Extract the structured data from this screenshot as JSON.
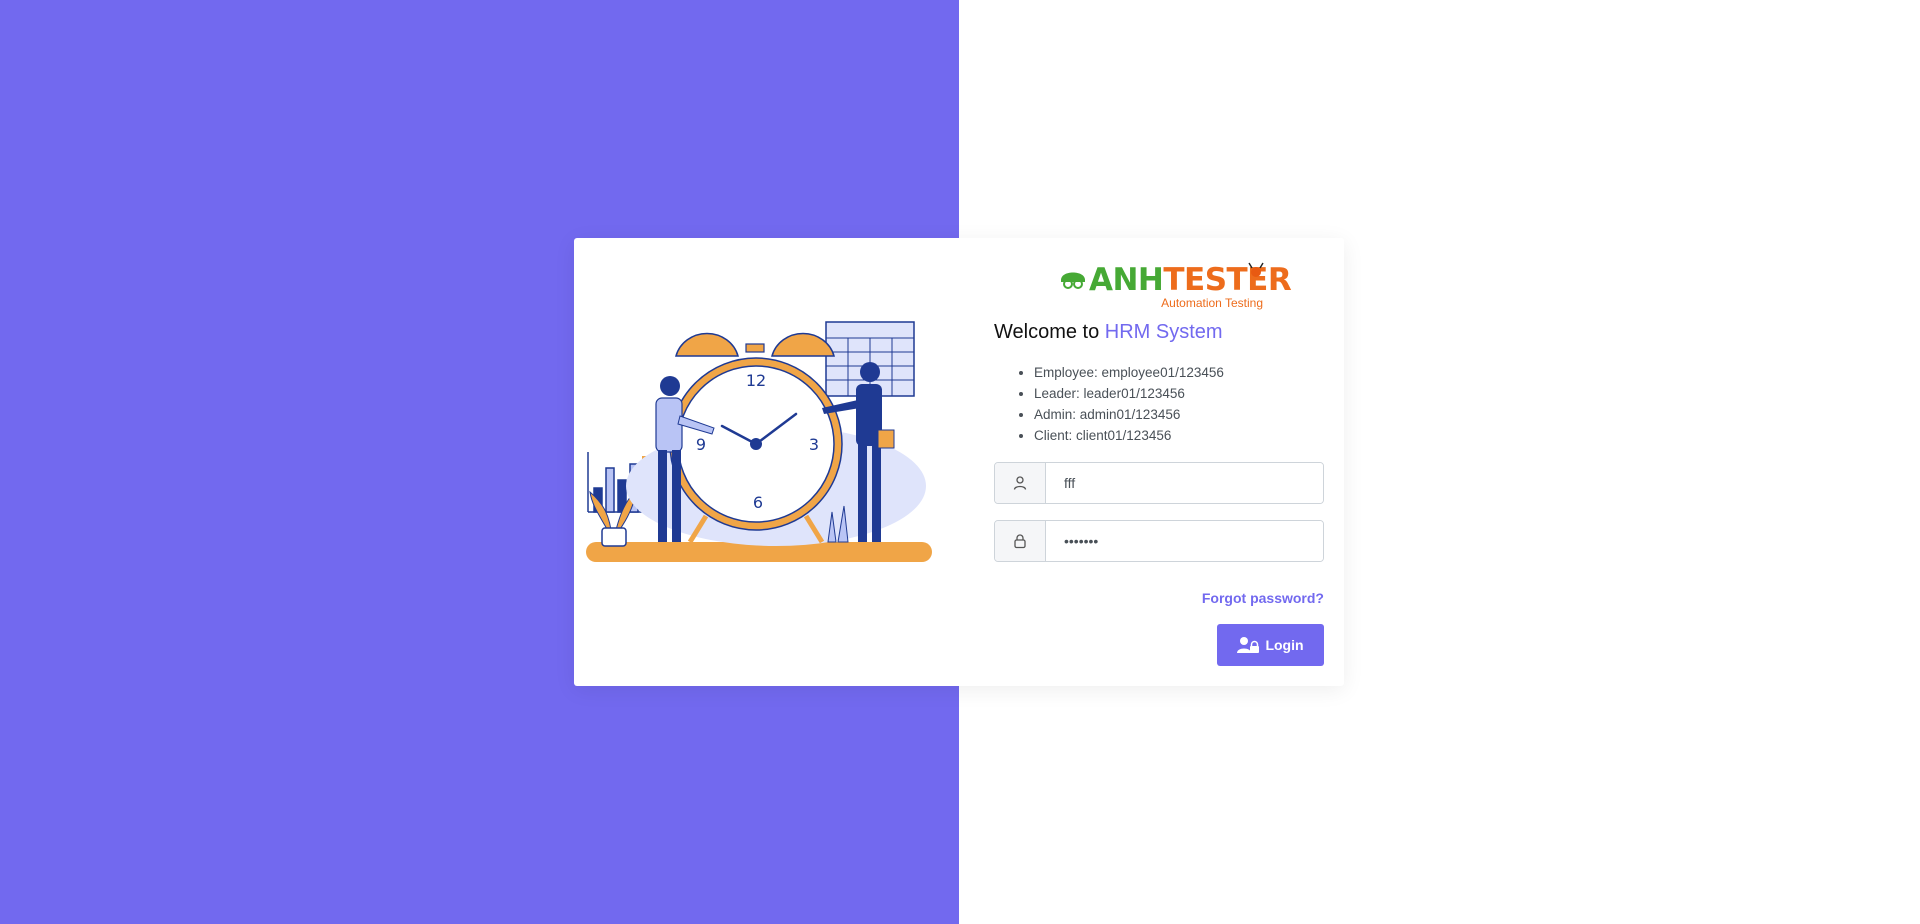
{
  "logo": {
    "brand_part1": "ANH",
    "brand_part2": "TESTER",
    "tagline": "Automation Testing"
  },
  "welcome": {
    "prefix": "Welcome to ",
    "highlight": "HRM System"
  },
  "credentials_hints": [
    "Employee: employee01/123456",
    "Leader: leader01/123456",
    "Admin: admin01/123456",
    "Client: client01/123456"
  ],
  "form": {
    "username_value": "fff",
    "password_value": "1234567",
    "forgot_label": "Forgot password?",
    "login_label": "Login"
  },
  "colors": {
    "accent": "#7269ef",
    "logo_green": "#46a935",
    "logo_orange": "#ed6c1c"
  }
}
